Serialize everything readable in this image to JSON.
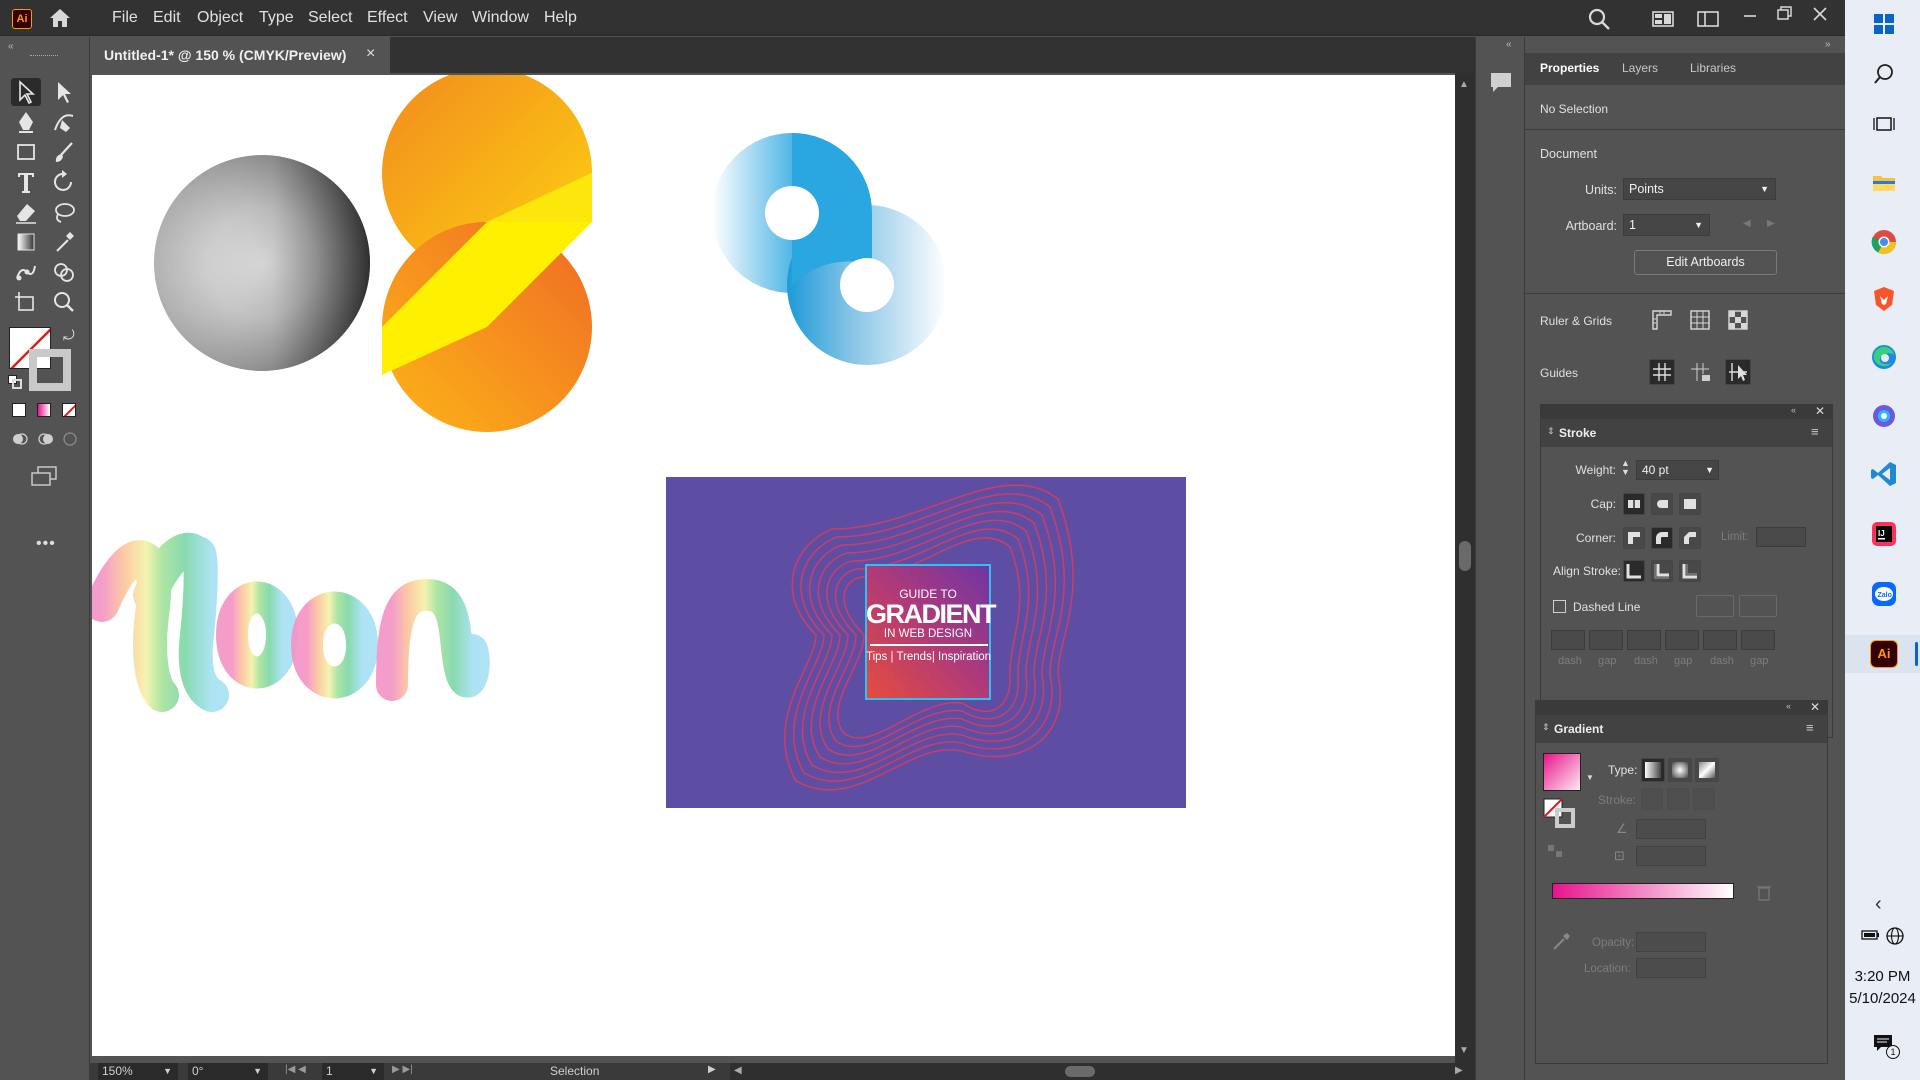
{
  "app": {
    "logo": "Ai"
  },
  "menu": [
    "File",
    "Edit",
    "Object",
    "Type",
    "Select",
    "Effect",
    "View",
    "Window",
    "Help"
  ],
  "document": {
    "tab_title": "Untitled-1* @ 150 % (CMYK/Preview)",
    "close": "×"
  },
  "status": {
    "zoom": "150%",
    "rotation": "0°",
    "artboard": "1",
    "mode": "Selection"
  },
  "panel_tabs": [
    "Properties",
    "Layers",
    "Libraries"
  ],
  "properties": {
    "no_selection": "No Selection",
    "document_heading": "Document",
    "units_label": "Units:",
    "units_value": "Points",
    "artboard_label": "Artboard:",
    "artboard_value": "1",
    "edit_artboards": "Edit Artboards",
    "ruler_grids": "Ruler & Grids",
    "guides": "Guides"
  },
  "stroke_panel": {
    "title": "Stroke",
    "weight_label": "Weight:",
    "weight_value": "40 pt",
    "cap_label": "Cap:",
    "corner_label": "Corner:",
    "limit_label": "Limit:",
    "align_label": "Align Stroke:",
    "dashed_line": "Dashed Line",
    "dash_labels": [
      "dash",
      "gap",
      "dash",
      "gap",
      "dash",
      "gap"
    ]
  },
  "gradient_panel": {
    "title": "Gradient",
    "type_label": "Type:",
    "stroke_label": "Stroke:",
    "opacity_label": "Opacity:",
    "location_label": "Location:",
    "colors": {
      "start": "#e8148c",
      "end": "#ffffff"
    }
  },
  "artwork": {
    "poster_line1": "GUIDE TO",
    "poster_line2": "GRADIENT",
    "poster_line3": "IN WEB DESIGN",
    "poster_line4": "Tips | Trends| Inspiration",
    "poster_bg": "#5e4ea3"
  },
  "taskbar": {
    "time": "3:20 PM",
    "date": "5/10/2024",
    "notifications": "1"
  }
}
